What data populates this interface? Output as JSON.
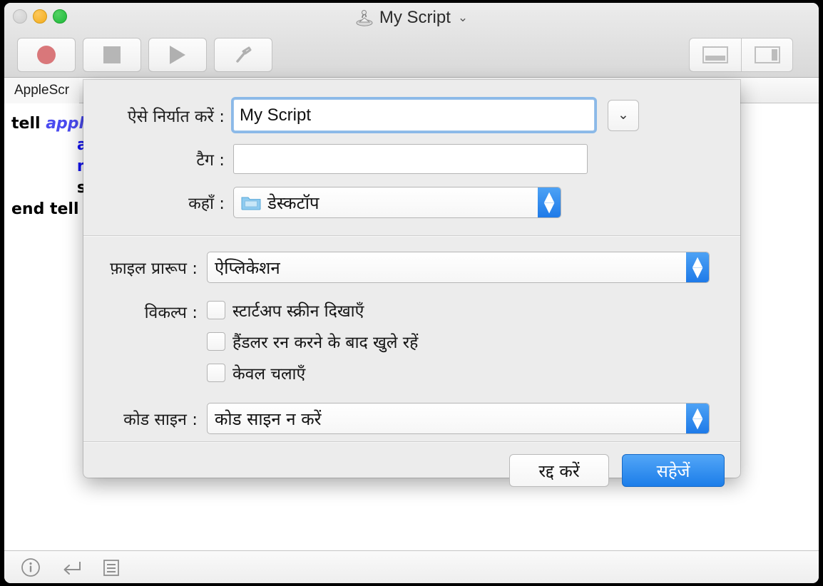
{
  "window": {
    "title": "My Script",
    "doc_icon": "applescript-document-icon",
    "title_chevron": "⌄",
    "traffic_lights": [
      {
        "name": "close",
        "color": "#cfcfcf"
      },
      {
        "name": "minimize",
        "color": "#f3ac1d"
      },
      {
        "name": "zoom",
        "color": "#1eb93a"
      }
    ]
  },
  "toolbar": {
    "left_buttons": [
      {
        "name": "record-button",
        "icon": "record-icon"
      },
      {
        "name": "stop-button",
        "icon": "stop-icon"
      },
      {
        "name": "run-button",
        "icon": "play-icon"
      },
      {
        "name": "compile-button",
        "icon": "hammer-icon"
      }
    ],
    "right_buttons": [
      {
        "name": "toggle-bottom-pane-button",
        "icon": "bottom-pane-icon"
      },
      {
        "name": "toggle-side-pane-button",
        "icon": "side-pane-icon"
      }
    ]
  },
  "editor": {
    "tab_label": "AppleScr",
    "code_lines": [
      {
        "indent": 0,
        "tokens": [
          {
            "text": "tell ",
            "style": "kw"
          },
          {
            "text": "appl",
            "style": "appl"
          }
        ]
      },
      {
        "indent": 3,
        "tokens": [
          {
            "text": "acti",
            "style": "blu"
          }
        ]
      },
      {
        "indent": 3,
        "tokens": [
          {
            "text": "ma",
            "style": "blu"
          }
        ]
      },
      {
        "indent": 3,
        "tokens": [
          {
            "text": "set",
            "style": "kw"
          }
        ]
      },
      {
        "indent": 0,
        "tokens": [
          {
            "text": "end tell",
            "style": "kw"
          }
        ]
      }
    ]
  },
  "statusbar": {
    "items": [
      {
        "name": "description-info-button",
        "icon": "info-circle-icon"
      },
      {
        "name": "result-button",
        "icon": "return-arrow-icon"
      },
      {
        "name": "log-button",
        "icon": "log-list-icon"
      }
    ]
  },
  "dialog": {
    "export_as_label": "ऐसे निर्यात करें :",
    "export_as_value": "My Script",
    "disclosure_icon": "⌄",
    "tags_label": "टैग :",
    "tags_value": "",
    "where_label": "कहाँ :",
    "where_value": "डेस्कटॉप",
    "where_icon": "folder-icon",
    "file_format_label": "फ़ाइल प्रारूप :",
    "file_format_value": "ऐप्लिकेशन",
    "options_label": "विकल्प :",
    "options": [
      {
        "label": "स्टार्टअप स्क्रीन दिखाएँ",
        "checked": false
      },
      {
        "label": "हैंडलर रन करने के बाद खुले रहें",
        "checked": false
      },
      {
        "label": "केवल चलाएँ",
        "checked": false
      }
    ],
    "code_sign_label": "कोड साइन :",
    "code_sign_value": "कोड साइन न करें",
    "cancel_label": "रद्द करें",
    "save_label": "सहेजें",
    "accent_color": "#1b7de9"
  }
}
